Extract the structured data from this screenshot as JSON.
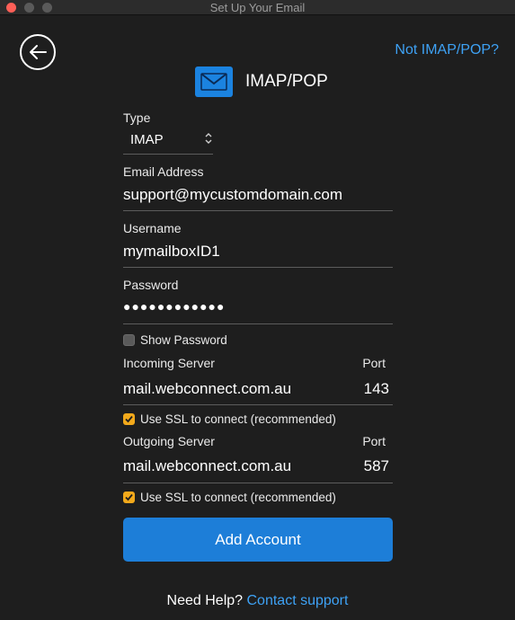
{
  "window": {
    "title": "Set Up Your Email"
  },
  "nav": {
    "not_imap_link": "Not IMAP/POP?"
  },
  "header": {
    "title": "IMAP/POP",
    "icon": "mail-envelope-icon"
  },
  "form": {
    "type": {
      "label": "Type",
      "value": "IMAP"
    },
    "email": {
      "label": "Email Address",
      "value": "support@mycustomdomain.com"
    },
    "username": {
      "label": "Username",
      "value": "mymailboxID1"
    },
    "password": {
      "label": "Password",
      "value": "●●●●●●●●●●●●"
    },
    "show_password": {
      "label": "Show Password",
      "checked": false
    },
    "incoming": {
      "label": "Incoming Server",
      "value": "mail.webconnect.com.au",
      "port_label": "Port",
      "port_value": "143",
      "ssl_label": "Use SSL to connect (recommended)",
      "ssl_checked": true
    },
    "outgoing": {
      "label": "Outgoing Server",
      "value": "mail.webconnect.com.au",
      "port_label": "Port",
      "port_value": "587",
      "ssl_label": "Use SSL to connect (recommended)",
      "ssl_checked": true
    }
  },
  "actions": {
    "add_account": "Add Account"
  },
  "help": {
    "prefix": "Need Help?",
    "link": "Contact support"
  },
  "colors": {
    "accent": "#1d7ed8",
    "link": "#3ea2f5",
    "checkbox": "#f2a91b",
    "background": "#1e1e1e"
  }
}
